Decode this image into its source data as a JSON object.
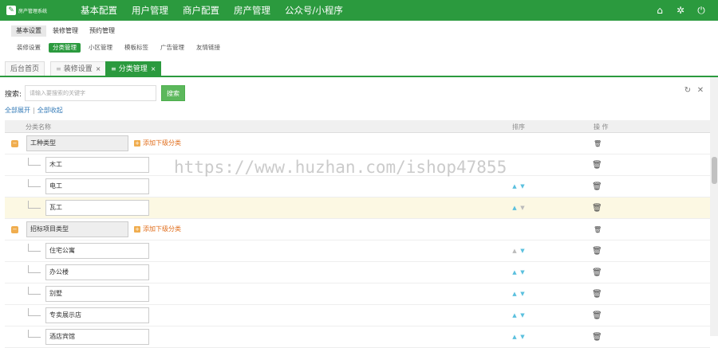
{
  "app": {
    "logo_text": "房产管理系统"
  },
  "topnav": [
    "基本配置",
    "用户管理",
    "商户配置",
    "房产管理",
    "公众号/小程序"
  ],
  "topicons": [
    "home-icon",
    "gear-icon",
    "power-icon"
  ],
  "subnav1": [
    "基本设置",
    "装修管理",
    "预约管理"
  ],
  "subnav2": [
    "装修设置",
    "分类管理",
    "小区管理",
    "模板标签",
    "广告管理",
    "友情链接"
  ],
  "tabs": {
    "home": "后台首页",
    "decor": "装修设置",
    "category": "分类管理"
  },
  "search": {
    "label": "搜索:",
    "placeholder": "请输入要搜索的关键字",
    "button": "搜索"
  },
  "links": {
    "expand_all": "全部展开",
    "collapse_all": "全部收起"
  },
  "table": {
    "headers": {
      "name": "分类名称",
      "sort": "排序",
      "action": "操 作"
    },
    "add_sub_label": "添加下级分类",
    "groups": [
      {
        "name": "工种类型",
        "children": [
          "木工",
          "电工",
          "瓦工"
        ]
      },
      {
        "name": "招标项目类型",
        "children": [
          "住宅公寓",
          "办公楼",
          "别墅",
          "专卖展示店",
          "酒店宾馆"
        ]
      }
    ]
  },
  "watermark": "https://www.huzhan.com/ishop47855"
}
